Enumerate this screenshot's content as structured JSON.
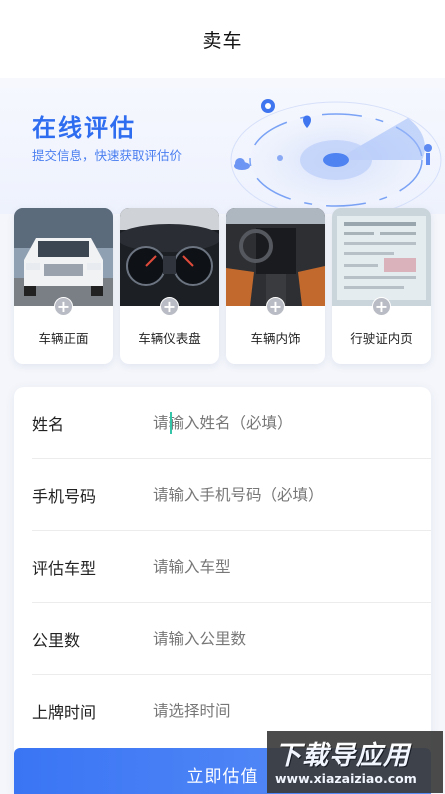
{
  "nav": {
    "title": "卖车"
  },
  "hero": {
    "title": "在线评估",
    "subtitle": "提交信息，快速获取评估价"
  },
  "photos": [
    {
      "label": "车辆正面",
      "plus": "+"
    },
    {
      "label": "车辆仪表盘",
      "plus": "+"
    },
    {
      "label": "车辆内饰",
      "plus": "+"
    },
    {
      "label": "行驶证内页",
      "plus": "+"
    }
  ],
  "form": {
    "rows": [
      {
        "label": "姓名",
        "placeholder": "请输入姓名（必填）",
        "value": ""
      },
      {
        "label": "手机号码",
        "placeholder": "请输入手机号码（必填）",
        "value": ""
      },
      {
        "label": "评估车型",
        "placeholder": "请输入车型",
        "value": ""
      },
      {
        "label": "公里数",
        "placeholder": "请输入公里数",
        "value": ""
      },
      {
        "label": "上牌时间",
        "placeholder": "请选择时间",
        "value": ""
      }
    ]
  },
  "submit": {
    "label": "立即估值"
  },
  "watermark": {
    "main": "下载导应用",
    "url": "www.xiazaiziao.com"
  },
  "colors": {
    "accent": "#2f6df0",
    "button": "#3a75f4",
    "cursor": "#35c4a8"
  }
}
